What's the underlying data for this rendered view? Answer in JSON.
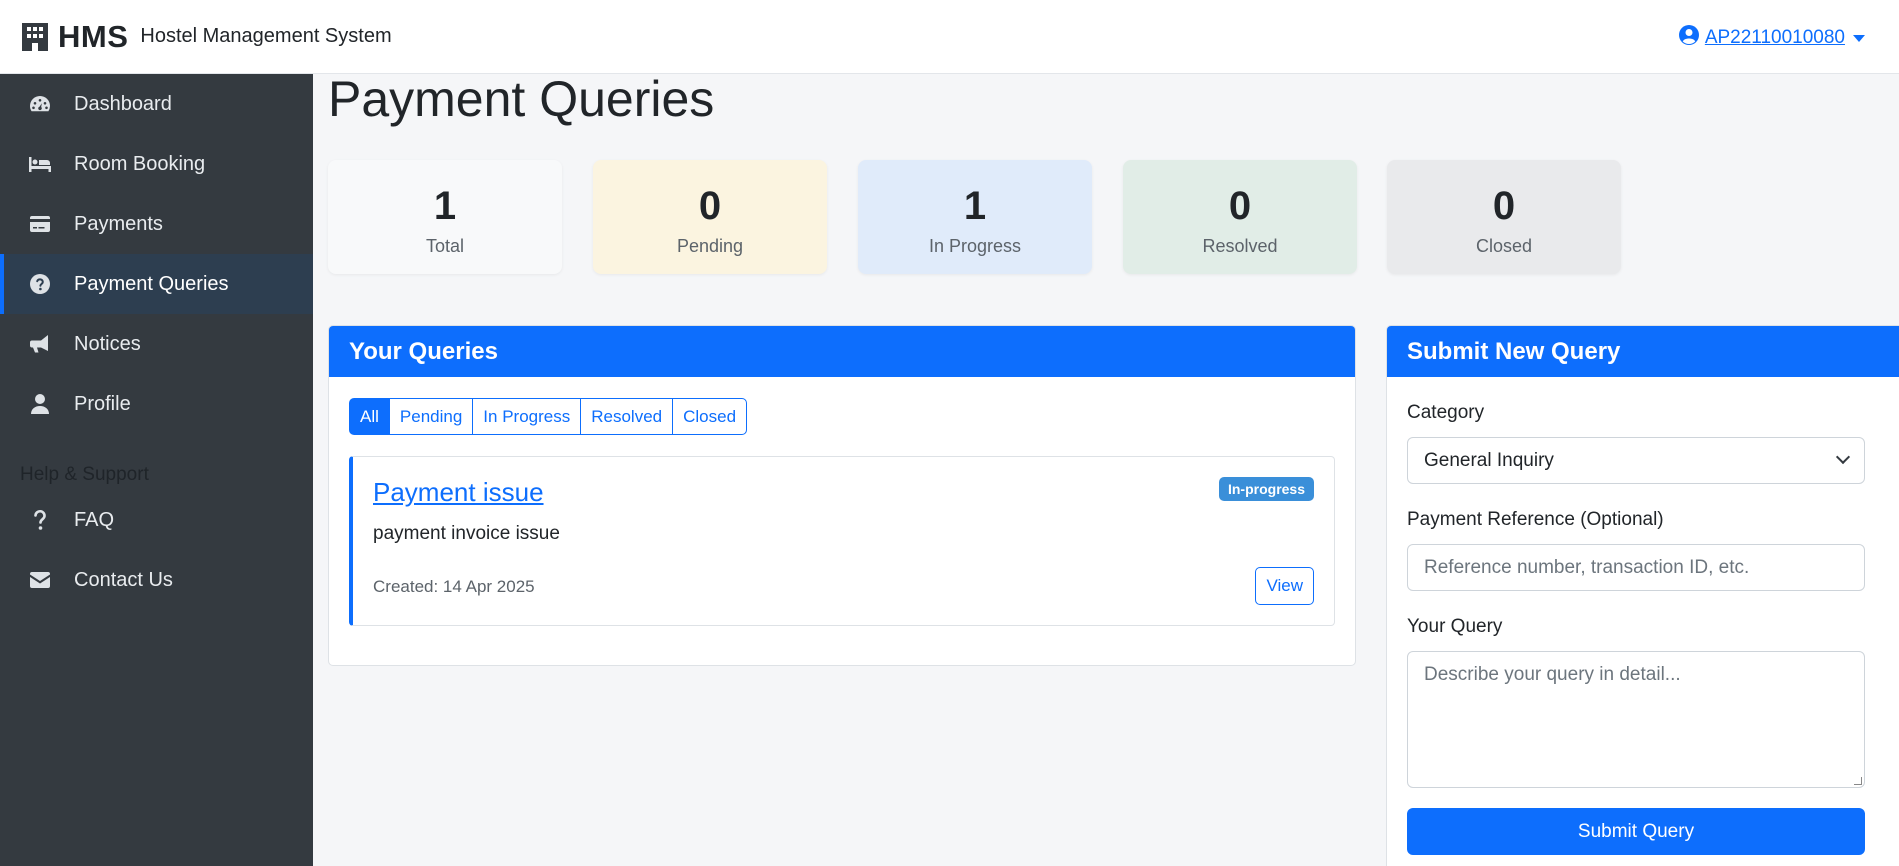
{
  "brand": {
    "short": "HMS",
    "full": "Hostel Management System"
  },
  "user": {
    "id": "AP22110010080"
  },
  "sidebar": {
    "items": [
      {
        "label": "Dashboard",
        "icon": "dashboard-icon"
      },
      {
        "label": "Room Booking",
        "icon": "bed-icon"
      },
      {
        "label": "Payments",
        "icon": "credit-card-icon"
      },
      {
        "label": "Payment Queries",
        "icon": "question-circle-icon",
        "active": true
      },
      {
        "label": "Notices",
        "icon": "megaphone-icon"
      },
      {
        "label": "Profile",
        "icon": "user-icon"
      }
    ],
    "section_title": "Help & Support",
    "support_items": [
      {
        "label": "FAQ",
        "icon": "question-icon"
      },
      {
        "label": "Contact Us",
        "icon": "envelope-icon"
      }
    ]
  },
  "page": {
    "title": "Payment Queries"
  },
  "stats": [
    {
      "value": "1",
      "label": "Total",
      "bg": "#f8f9fa"
    },
    {
      "value": "0",
      "label": "Pending",
      "bg": "#fbf4e0"
    },
    {
      "value": "1",
      "label": "In Progress",
      "bg": "#e0ebfa"
    },
    {
      "value": "0",
      "label": "Resolved",
      "bg": "#e1ede7"
    },
    {
      "value": "0",
      "label": "Closed",
      "bg": "#e9eaec"
    }
  ],
  "queries_card": {
    "title": "Your Queries",
    "filters": [
      "All",
      "Pending",
      "In Progress",
      "Resolved",
      "Closed"
    ],
    "active_filter": "All",
    "items": [
      {
        "title": "Payment issue",
        "status": "In-progress",
        "description": "payment invoice issue",
        "created": "Created: 14 Apr 2025",
        "action": "View"
      }
    ]
  },
  "submit_card": {
    "title": "Submit New Query",
    "category_label": "Category",
    "category_value": "General Inquiry",
    "reference_label": "Payment Reference (Optional)",
    "reference_placeholder": "Reference number, transaction ID, etc.",
    "query_label": "Your Query",
    "query_placeholder": "Describe your query in detail...",
    "submit_label": "Submit Query"
  },
  "colors": {
    "primary": "#0d6efd",
    "sidebar_bg": "#343a40",
    "active_bg": "#2d3e50",
    "badge": "#3a8fd9"
  }
}
